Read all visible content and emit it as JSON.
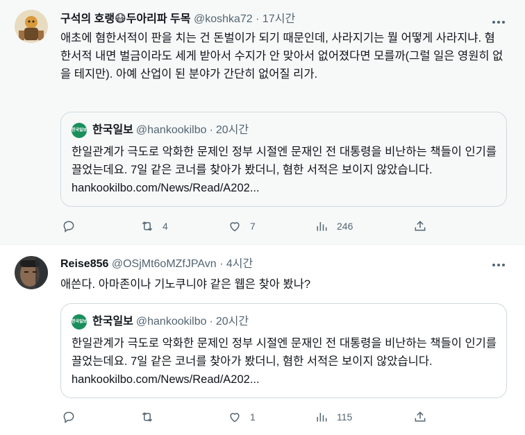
{
  "tweets": [
    {
      "name": "구석의 호랭😷두아리파 두목",
      "handle": "@koshka72",
      "dot": "·",
      "time": "17시간",
      "text": "애초에 혐한서적이 판을 치는 건 돈벌이가 되기 때문인데, 사라지기는 뭘 어떻게 사라지냐. 혐한서적 내면 벌금이라도 세게 받아서 수지가 안 맞아서 없어졌다면 모를까(그럴 일은 영원히 없을 테지만). 아예 산업이 된 분야가 간단히 없어질 리가.",
      "quote": {
        "logo_text": "한국일보",
        "name": "한국일보",
        "handle": "@hankookilbo",
        "dot": "·",
        "time": "20시간",
        "text": "한일관계가 극도로 악화한 문제인 정부 시절엔 문재인 전 대통령을 비난하는 책들이 인기를 끌었는데요. 7일 같은 코너를 찾아가 봤더니, 혐한 서적은 보이지 않았습니다.  hankookilbo.com/News/Read/A202..."
      },
      "actions": {
        "reply": "",
        "retweet": "4",
        "like": "7",
        "views": "246"
      }
    },
    {
      "name": "Reise856",
      "handle": "@OSjMt6oMZfJPAvn",
      "dot": "·",
      "time": "4시간",
      "text": "애쓴다. 아마존이나 기노쿠니야 같은 웹은 찾아 봤나?",
      "quote": {
        "logo_text": "한국일보",
        "name": "한국일보",
        "handle": "@hankookilbo",
        "dot": "·",
        "time": "20시간",
        "text": "한일관계가 극도로 악화한 문제인 정부 시절엔 문재인 전 대통령을 비난하는 책들이 인기를 끌었는데요. 7일 같은 코너를 찾아가 봤더니, 혐한 서적은 보이지 않았습니다.  hankookilbo.com/News/Read/A202..."
      },
      "actions": {
        "reply": "",
        "retweet": "",
        "like": "1",
        "views": "115"
      }
    }
  ]
}
